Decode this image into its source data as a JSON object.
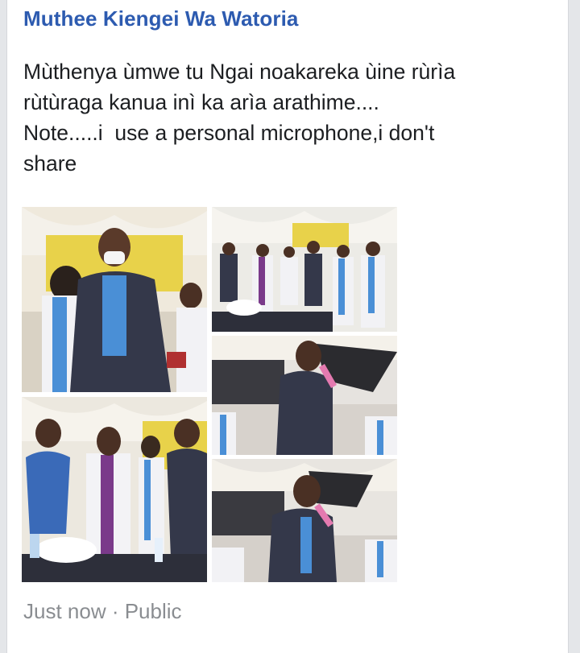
{
  "post": {
    "author": "Muthee Kiengei Wa Watoria",
    "message_lines": [
      "Mùthenya ùmwe tu Ngai noakareka ùine rùrìa",
      "rùtùraga kanua inì ka arìa arathime....",
      "Note.....i  use a personal microphone,i don't",
      "share"
    ],
    "timestamp": "Just now",
    "separator": " · ",
    "visibility": "Public"
  },
  "photos": [
    {
      "name": "photo-clergy-group-1"
    },
    {
      "name": "photo-clergy-line-up"
    },
    {
      "name": "photo-speaker-microphone-1"
    },
    {
      "name": "photo-clergy-group-2"
    },
    {
      "name": "photo-speaker-microphone-2"
    }
  ],
  "colors": {
    "author_link": "#2d5bb0",
    "text": "#1c1e21",
    "meta": "#8a8d91",
    "tent_yellow": "#e8d24a",
    "stole_blue": "#4a8fd6",
    "suit_dark": "#34384a"
  }
}
